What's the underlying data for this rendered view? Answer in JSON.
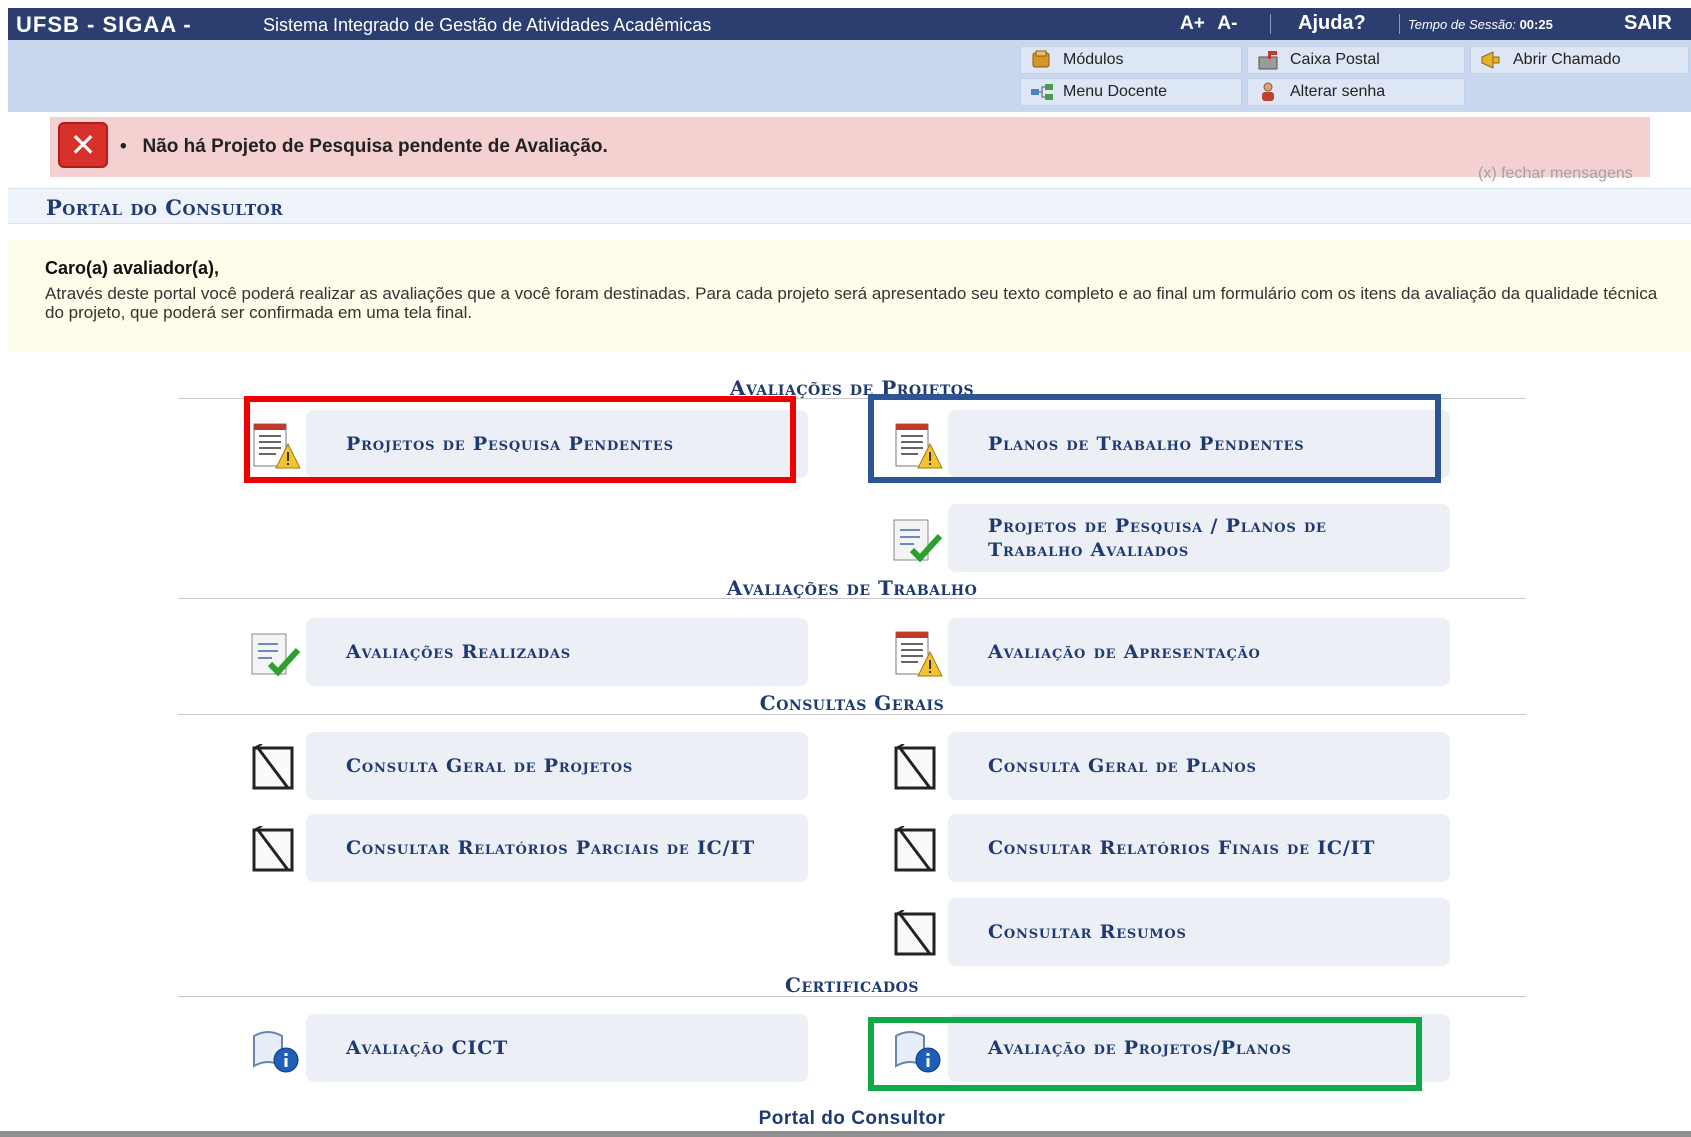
{
  "topbar": {
    "brand": "UFSB - SIGAA -",
    "system": "Sistema Integrado de Gestão de Atividades Acadêmicas",
    "font_increase": "A+",
    "font_decrease": "A-",
    "help": "Ajuda?",
    "session_label": "Tempo de Sessão:",
    "session_time": "00:25",
    "logout": "SAIR"
  },
  "menu": {
    "modulos": "Módulos",
    "caixa_postal": "Caixa Postal",
    "abrir_chamado": "Abrir Chamado",
    "menu_docente": "Menu Docente",
    "alterar_senha": "Alterar senha"
  },
  "message": {
    "text": "Não há Projeto de Pesquisa pendente de Avaliação.",
    "bullet": "•",
    "close": "(x) fechar mensagens"
  },
  "portal": {
    "title": "Portal do Consultor",
    "footer": "Portal do Consultor"
  },
  "intro": {
    "greeting": "Caro(a) avaliador(a),",
    "body": "Através deste portal você poderá realizar as avaliações que a você foram destinadas. Para cada projeto será apresentado seu texto completo e ao final um formulário com os itens da avaliação da qualidade técnica do projeto, que poderá ser confirmada em uma tela final."
  },
  "sections": {
    "avaliacoes_projetos": {
      "title": "Avaliações de Projetos",
      "projetos_pendentes": "Projetos de Pesquisa Pendentes",
      "planos_pendentes": "Planos de Trabalho Pendentes",
      "avaliados": "Projetos de Pesquisa / Planos de Trabalho Avaliados"
    },
    "avaliacoes_trabalho": {
      "title": "Avaliações de Trabalho",
      "realizadas": "Avaliações Realizadas",
      "apresentacao": "Avaliação de Apresentação"
    },
    "consultas": {
      "title": "Consultas Gerais",
      "projetos": "Consulta Geral de Projetos",
      "planos": "Consulta Geral de Planos",
      "parciais": "Consultar Relatórios Parciais de IC/IT",
      "finais": "Consultar Relatórios Finais de IC/IT",
      "resumos": "Consultar Resumos"
    },
    "certificados": {
      "title": "Certificados",
      "cict": "Avaliação CICT",
      "projetos_planos": "Avaliação de Projetos/Planos"
    }
  },
  "highlights": {
    "red": "#f00000",
    "blue": "#2d5594",
    "green": "#11a84a"
  }
}
